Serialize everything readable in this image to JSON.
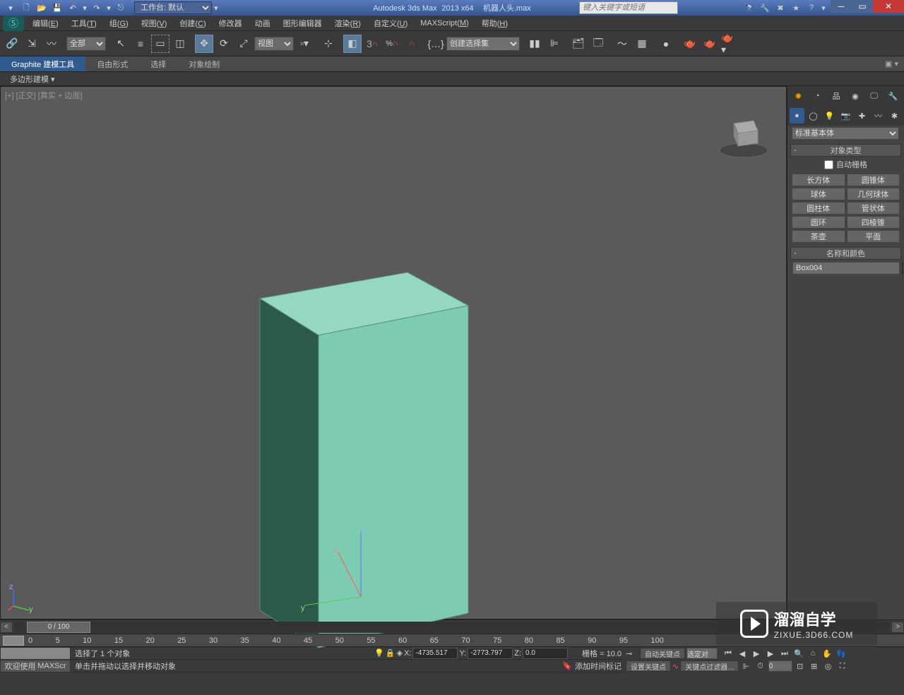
{
  "title": {
    "app": "Autodesk 3ds Max",
    "version": "2013 x64",
    "file": "机器人头.max"
  },
  "title_icons": [
    "file-new",
    "file-open",
    "file-save",
    "separator",
    "undo",
    "redo",
    "separator",
    "link"
  ],
  "workspace": {
    "label": "工作台: 默认"
  },
  "search": {
    "placeholder": "键入关键字或短语"
  },
  "menus": [
    {
      "label": "编辑",
      "key": "E"
    },
    {
      "label": "工具",
      "key": "T"
    },
    {
      "label": "组",
      "key": "G"
    },
    {
      "label": "视图",
      "key": "V"
    },
    {
      "label": "创建",
      "key": "C"
    },
    {
      "label": "修改器",
      "key": ""
    },
    {
      "label": "动画",
      "key": ""
    },
    {
      "label": "图形编辑器",
      "key": ""
    },
    {
      "label": "渲染",
      "key": "R"
    },
    {
      "label": "自定义",
      "key": "U"
    },
    {
      "label": "MAXScript",
      "key": "M"
    },
    {
      "label": "帮助",
      "key": "H"
    }
  ],
  "toolbar": {
    "selection_filter": "全部",
    "view_ref": "视图",
    "named_set": "创建选择集"
  },
  "ribbon": {
    "tabs": [
      "Graphite 建模工具",
      "自由形式",
      "选择",
      "对象绘制"
    ],
    "active": 0,
    "sub": "多边形建模"
  },
  "viewport": {
    "label_plus": "[+]",
    "label_view": "[正交]",
    "label_shading": "[真实 + 边面]",
    "axes": {
      "x": "x",
      "y": "y",
      "z": "z"
    }
  },
  "right_panel": {
    "dropdown": "标准基本体",
    "rollout_type": "对象类型",
    "auto_grid": "自动栅格",
    "buttons": [
      [
        "长方体",
        "圆锥体"
      ],
      [
        "球体",
        "几何球体"
      ],
      [
        "圆柱体",
        "管状体"
      ],
      [
        "圆环",
        "四棱锥"
      ],
      [
        "茶壶",
        "平面"
      ]
    ],
    "rollout_name": "名称和颜色",
    "object_name": "Box004",
    "object_color": "#6dcaa8"
  },
  "timeline": {
    "frame_display": "0 / 100",
    "ticks": [
      "0",
      "5",
      "10",
      "15",
      "20",
      "25",
      "30",
      "35",
      "40",
      "45",
      "50",
      "55",
      "60",
      "65",
      "70",
      "75",
      "80",
      "85",
      "90",
      "95",
      "100"
    ]
  },
  "status": {
    "welcome": "欢迎使用",
    "maxscript": "MAXScr",
    "selected": "选择了 1 个对象",
    "hint": "单击并拖动以选择并移动对象",
    "coords": {
      "x_label": "X:",
      "x": "-4735.517",
      "y_label": "Y:",
      "y": "-2773.797",
      "z_label": "Z:",
      "z": "0.0"
    },
    "grid": "栅格 = 10.0",
    "add_time_tag": "添加时间标记",
    "auto_key": "自动关键点",
    "set_key": "设置关键点",
    "selected_obj_field": "选定对",
    "key_filter": "关键点过滤器...",
    "frame_field": "0"
  },
  "watermark": {
    "cn": "溜溜自学",
    "url": "ZIXUE.3D66.COM"
  }
}
